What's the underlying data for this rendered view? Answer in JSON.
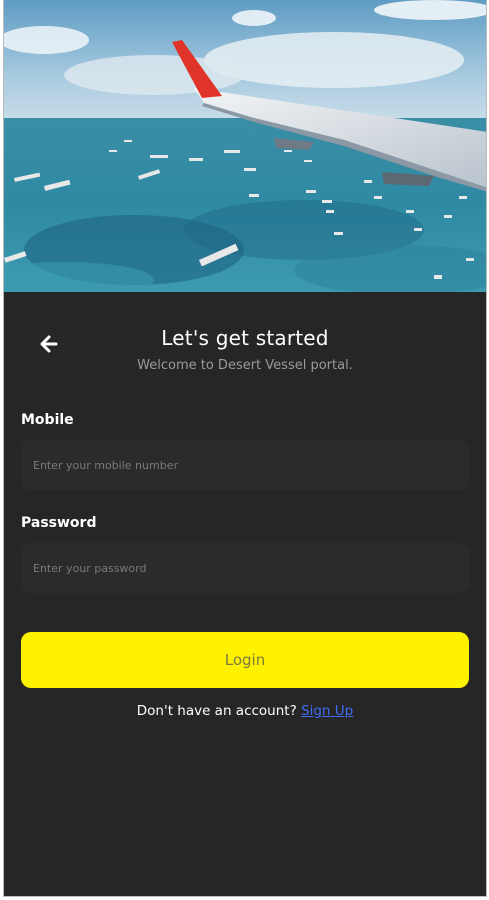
{
  "hero": {
    "image": "aerial view of sea with ships and airplane wing"
  },
  "header": {
    "back_icon": "arrow-left-icon",
    "title": "Let's get started",
    "subtitle": "Welcome to Desert Vessel portal."
  },
  "form": {
    "mobile": {
      "label": "Mobile",
      "placeholder": "Enter your mobile number",
      "value": ""
    },
    "password": {
      "label": "Password",
      "placeholder": "Enter your password",
      "value": ""
    },
    "login_label": "Login"
  },
  "footer": {
    "prompt": "Don't have an account?",
    "signup_label": "Sign Up"
  },
  "colors": {
    "background": "#262626",
    "input_bg": "#2b2b2b",
    "accent": "#fff200",
    "link": "#3f6df2"
  }
}
